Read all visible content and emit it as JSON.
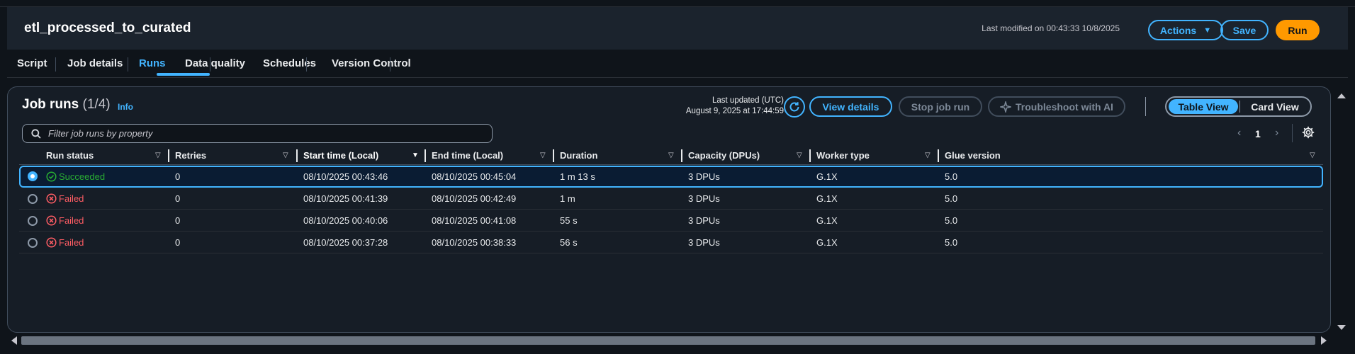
{
  "header": {
    "title": "etl_processed_to_curated",
    "last_modified": "Last modified on 00:43:33 10/8/2025",
    "actions_label": "Actions",
    "save_label": "Save",
    "run_label": "Run"
  },
  "tabs": [
    {
      "label": "Script"
    },
    {
      "label": "Job details"
    },
    {
      "label": "Runs"
    },
    {
      "label": "Data quality"
    },
    {
      "label": "Schedules"
    },
    {
      "label": "Version Control"
    }
  ],
  "active_tab": "Runs",
  "panel": {
    "title": "Job runs",
    "count": "(1/4)",
    "info_link": "Info",
    "updated_line1": "Last updated (UTC)",
    "updated_line2": "August 9, 2025 at 17:44:59",
    "view_details_label": "View details",
    "stop_label": "Stop job run",
    "troubleshoot_label": "Troubleshoot with AI",
    "table_view_label": "Table View",
    "card_view_label": "Card View",
    "search_placeholder": "Filter job runs by property",
    "page_number": "1"
  },
  "columns": [
    "Run status",
    "Retries",
    "Start time (Local)",
    "End time (Local)",
    "Duration",
    "Capacity (DPUs)",
    "Worker type",
    "Glue version"
  ],
  "sorted_column": "Start time (Local)",
  "rows": [
    {
      "status": "Succeeded",
      "retries": "0",
      "start": "08/10/2025 00:43:46",
      "end": "08/10/2025 00:45:04",
      "duration": "1 m 13 s",
      "capacity": "3 DPUs",
      "worker": "G.1X",
      "glue": "5.0",
      "selected": true
    },
    {
      "status": "Failed",
      "retries": "0",
      "start": "08/10/2025 00:41:39",
      "end": "08/10/2025 00:42:49",
      "duration": "1 m",
      "capacity": "3 DPUs",
      "worker": "G.1X",
      "glue": "5.0",
      "selected": false
    },
    {
      "status": "Failed",
      "retries": "0",
      "start": "08/10/2025 00:40:06",
      "end": "08/10/2025 00:41:08",
      "duration": "55 s",
      "capacity": "3 DPUs",
      "worker": "G.1X",
      "glue": "5.0",
      "selected": false
    },
    {
      "status": "Failed",
      "retries": "0",
      "start": "08/10/2025 00:37:28",
      "end": "08/10/2025 00:38:33",
      "duration": "56 s",
      "capacity": "3 DPUs",
      "worker": "G.1X",
      "glue": "5.0",
      "selected": false
    }
  ],
  "colors": {
    "accent": "#42b4ff",
    "run_button": "#ff9900",
    "success": "#29ad32",
    "failed": "#ff5d64"
  }
}
